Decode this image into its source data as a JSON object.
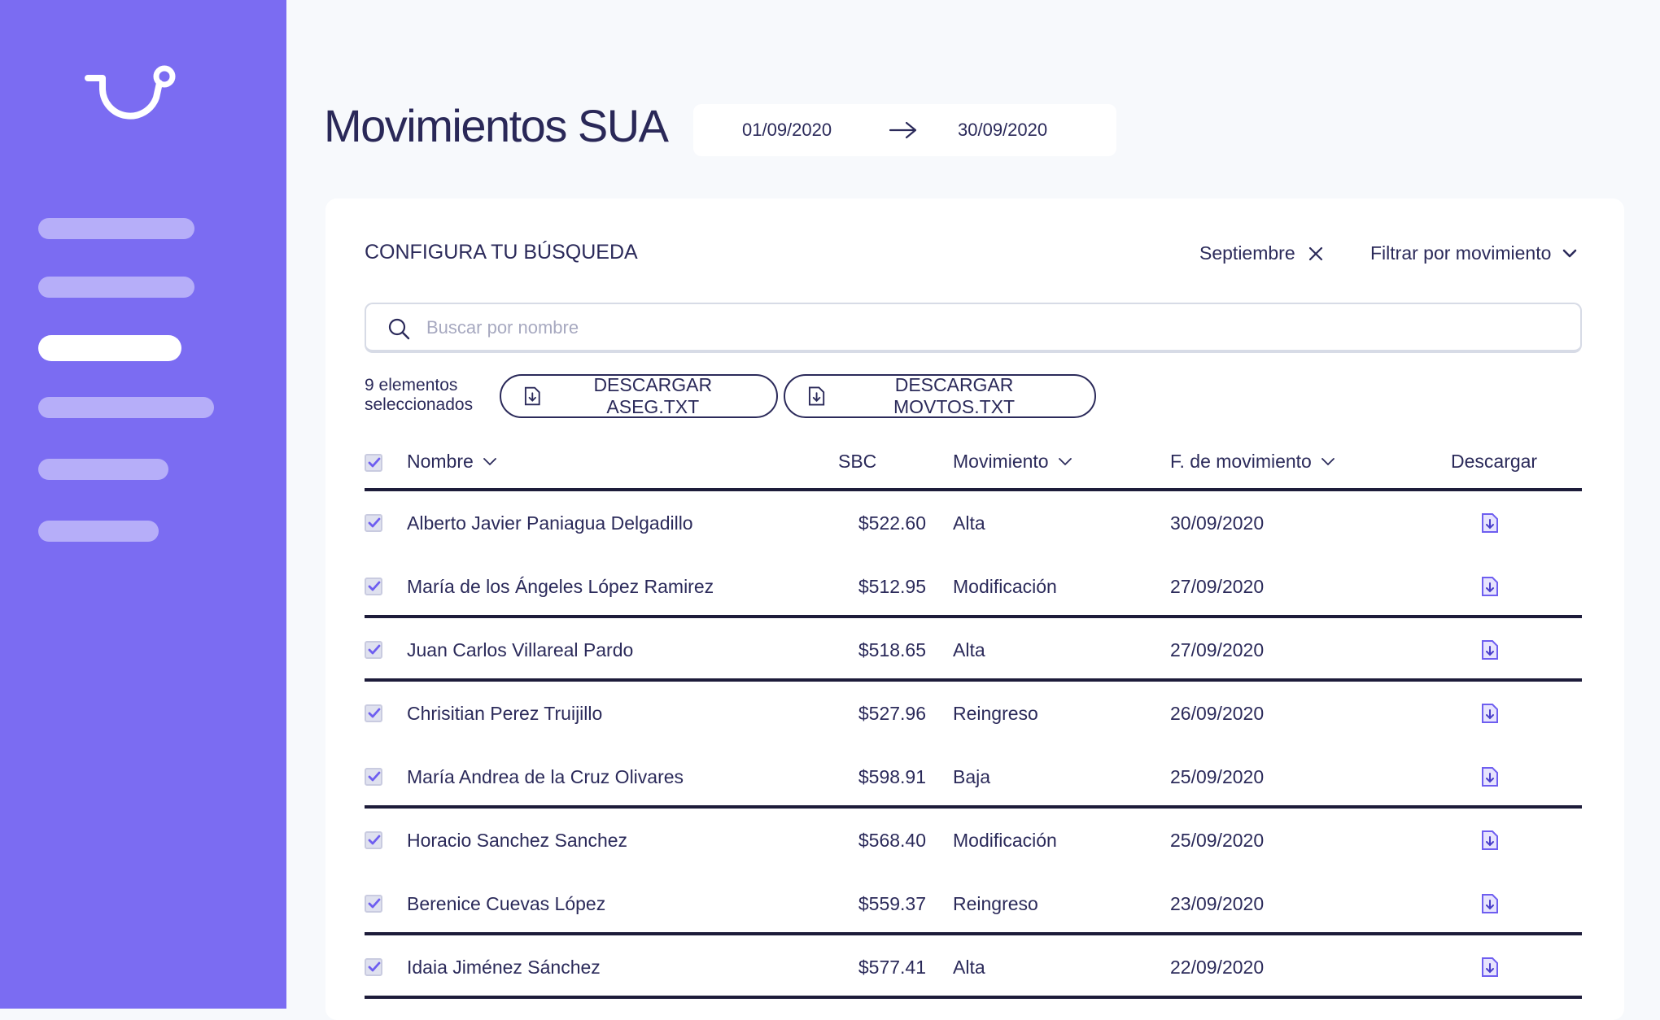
{
  "page": {
    "title": "Movimientos SUA",
    "date_from": "01/09/2020",
    "date_to": "30/09/2020"
  },
  "colors": {
    "sidebar": "#7b6cf2",
    "accent": "#7b6cf2",
    "text": "#2b2a5a"
  },
  "sidebar": {
    "nav_items": [
      {
        "state": "inactive"
      },
      {
        "state": "inactive"
      },
      {
        "state": "active"
      },
      {
        "state": "inactive"
      },
      {
        "state": "inactive"
      },
      {
        "state": "inactive"
      }
    ]
  },
  "search_panel": {
    "title": "CONFIGURA TU BÚSQUEDA",
    "month_chip": "Septiembre",
    "filter_label": "Filtrar por movimiento",
    "search_placeholder": "Buscar por nombre",
    "search_value": ""
  },
  "actions": {
    "selected_line1": "9 elementos",
    "selected_line2": "seleccionados",
    "download_aseg": "DESCARGAR ASEG.TXT",
    "download_movtos": "DESCARGAR MOVTOS.TXT"
  },
  "table": {
    "headers": {
      "name": "Nombre",
      "sbc": "SBC",
      "movement": "Movimiento",
      "movement_date": "F. de movimiento",
      "download": "Descargar"
    },
    "rows": [
      {
        "name": "Alberto Javier Paniagua Delgadillo",
        "sbc": "$522.60",
        "movement": "Alta",
        "date": "30/09/2020",
        "checked": true
      },
      {
        "name": "María de los Ángeles López Ramirez",
        "sbc": "$512.95",
        "movement": "Modificación",
        "date": "27/09/2020",
        "checked": true
      },
      {
        "name": "Juan Carlos Villareal Pardo",
        "sbc": "$518.65",
        "movement": "Alta",
        "date": "27/09/2020",
        "checked": true
      },
      {
        "name": "Chrisitian Perez Truijillo",
        "sbc": "$527.96",
        "movement": "Reingreso",
        "date": "26/09/2020",
        "checked": true
      },
      {
        "name": "María Andrea de la Cruz Olivares",
        "sbc": "$598.91",
        "movement": "Baja",
        "date": "25/09/2020",
        "checked": true
      },
      {
        "name": "Horacio Sanchez Sanchez",
        "sbc": "$568.40",
        "movement": "Modificación",
        "date": "25/09/2020",
        "checked": true
      },
      {
        "name": "Berenice Cuevas López",
        "sbc": "$559.37",
        "movement": "Reingreso",
        "date": "23/09/2020",
        "checked": true
      },
      {
        "name": "Idaia Jiménez Sánchez",
        "sbc": "$577.41",
        "movement": "Alta",
        "date": "22/09/2020",
        "checked": true
      }
    ]
  }
}
